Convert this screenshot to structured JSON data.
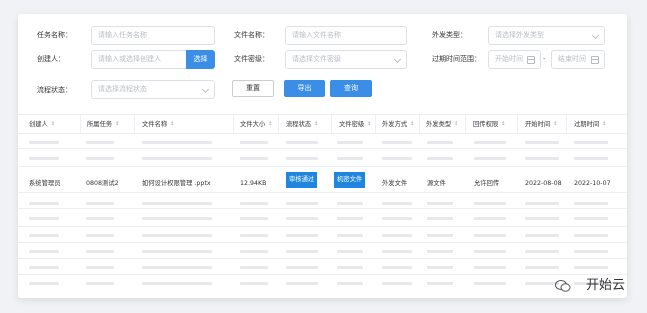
{
  "filters": {
    "task_name": {
      "label": "任务名称：",
      "placeholder": "请输入任务名称"
    },
    "file_name": {
      "label": "文件名称：",
      "placeholder": "请输入文件名称"
    },
    "send_type": {
      "label": "外发类型：",
      "placeholder": "请选择外发类型"
    },
    "creator": {
      "label": "创建人：",
      "placeholder": "请输入或选择创建人",
      "select_button": "选择"
    },
    "file_security": {
      "label": "文件密级：",
      "placeholder": "请选择文件密级"
    },
    "expire_range": {
      "label": "过期时间范围：",
      "start_placeholder": "开始时间",
      "separator": "-",
      "end_placeholder": "结束时间"
    },
    "flow_status": {
      "label": "流程状态：",
      "placeholder": "请选择流程状态"
    }
  },
  "actions": {
    "reset": "重置",
    "export": "导出",
    "query": "查询"
  },
  "table": {
    "columns": [
      "创建人",
      "所属任务",
      "文件名称",
      "文件大小",
      "流程状态",
      "文件密级",
      "外发方式",
      "外发类型",
      "回传权限",
      "开始时间",
      "过期时间"
    ],
    "row": {
      "creator": "系统管理员",
      "task": "0808测试2",
      "file_name": "如何设计权限管理 .pptx",
      "file_size": "12.94KB",
      "flow_status": "审核通过",
      "security": "机密文件",
      "send_method": "外发文件",
      "send_type": "源文件",
      "return_permission": "允许回传",
      "start_time": "2022-08-08",
      "expire_time": "2022-10-07"
    }
  },
  "watermark": {
    "text": "开始云",
    "icon": "wechat-icon"
  },
  "colors": {
    "primary": "#3a8ee6",
    "tag": "#1f86e0"
  }
}
